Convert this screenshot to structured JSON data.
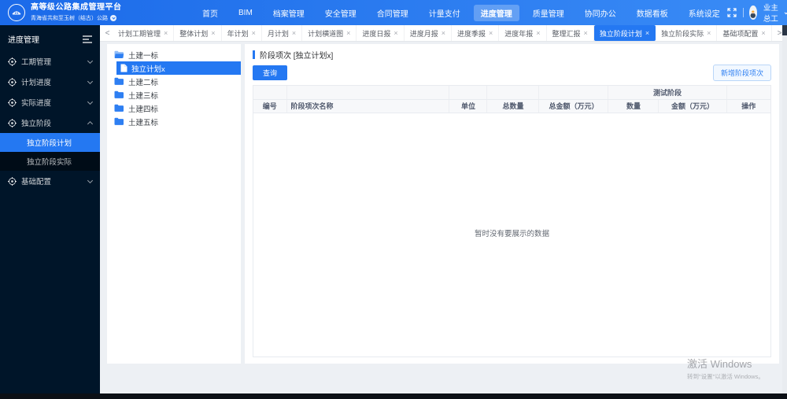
{
  "header": {
    "title": "高等级公路集成管理平台",
    "subtitle": "青海省共和至玉树（结古）公路",
    "nav": [
      {
        "label": "首页"
      },
      {
        "label": "BIM"
      },
      {
        "label": "档案管理"
      },
      {
        "label": "安全管理"
      },
      {
        "label": "合同管理"
      },
      {
        "label": "计量支付"
      },
      {
        "label": "进度管理",
        "active": true
      },
      {
        "label": "质量管理"
      },
      {
        "label": "协同办公"
      },
      {
        "label": "数据看板"
      },
      {
        "label": "系统设定"
      }
    ],
    "user": {
      "name": "业主总工"
    }
  },
  "sidebar": {
    "title": "进度管理",
    "items": [
      {
        "label": "工期管理"
      },
      {
        "label": "计划进度"
      },
      {
        "label": "实际进度"
      },
      {
        "label": "独立阶段",
        "expanded": true
      },
      {
        "label": "基础配置"
      }
    ],
    "submenu": [
      {
        "label": "独立阶段计划",
        "active": true
      },
      {
        "label": "独立阶段实际"
      }
    ]
  },
  "tabs": [
    {
      "label": "计划工期管理"
    },
    {
      "label": "整体计划"
    },
    {
      "label": "年计划"
    },
    {
      "label": "月计划"
    },
    {
      "label": "计划横道图"
    },
    {
      "label": "进度日报"
    },
    {
      "label": "进度月报"
    },
    {
      "label": "进度季报"
    },
    {
      "label": "进度年报"
    },
    {
      "label": "整理汇报"
    },
    {
      "label": "独立阶段计划",
      "active": true
    },
    {
      "label": "独立阶段实际"
    },
    {
      "label": "基础项配置"
    }
  ],
  "tree": {
    "folders": [
      "土建一标",
      "土建二标",
      "土建三标",
      "土建四标",
      "土建五标"
    ],
    "selected_child": "独立计划x"
  },
  "panel": {
    "title": "阶段项次 [独立计划x]",
    "query_button": "查询",
    "add_button": "新增阶段项次"
  },
  "table": {
    "group_header": "测试阶段",
    "columns": [
      "编号",
      "阶段项次名称",
      "单位",
      "总数量",
      "总金额（万元）",
      "数量",
      "金额（万元）",
      "操作"
    ],
    "empty_text": "暂时没有要展示的数据"
  },
  "watermark": {
    "line1": "激活 Windows",
    "line2": "转到\"设置\"以激活 Windows。"
  },
  "icons": {
    "tab_close": "×",
    "scroll_left": "<",
    "scroll_right": ">"
  },
  "colors": {
    "accent_blue": "#2478f2",
    "header_gradient_start": "#1b6ae9",
    "header_gradient_end": "#3a8cf6",
    "sidebar_bg": "#001529",
    "submenu_bg": "#000c17"
  }
}
